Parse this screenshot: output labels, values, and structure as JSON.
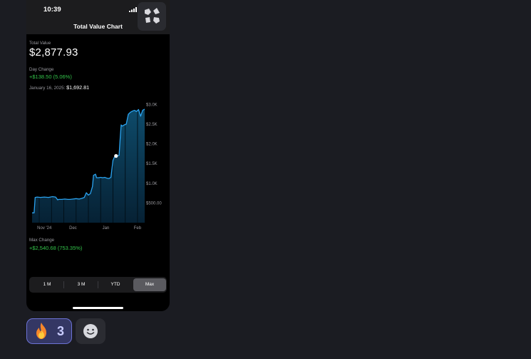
{
  "status_bar": {
    "time": "10:39"
  },
  "nav": {
    "title": "Total Value Chart"
  },
  "summary": {
    "total_value_label": "Total Value",
    "total_value": "$2,877.93",
    "day_change_label": "Day Change",
    "day_change": "+$138.50 (5.06%)",
    "selected_date": "January 16, 2025:",
    "selected_value": "$1,692.81",
    "max_change_label": "Max Change",
    "max_change": "+$2,540.68 (753.35%)"
  },
  "range_selector": {
    "options": [
      "1 M",
      "3 M",
      "YTD",
      "Max"
    ],
    "selected": "Max"
  },
  "reactions": [
    {
      "emoji": "🔥",
      "count": "3",
      "icon": "fire-icon"
    },
    {
      "icon": "smiley-add-icon"
    }
  ],
  "colors": {
    "line": "#2aa3f0",
    "fill_top": "#0f4f70",
    "positive": "#33c44a",
    "reaction_accent": "#6c72d4"
  },
  "chart_data": {
    "type": "area",
    "x_tick_labels": [
      "Nov '24",
      "Dec",
      "Jan",
      "Feb"
    ],
    "y_tick_labels": [
      "$500.00",
      "$1.0K",
      "$1.5K",
      "$2.0K",
      "$2.5K",
      "$3.0K"
    ],
    "y_ticks": [
      500,
      1000,
      1500,
      2000,
      2500,
      3000
    ],
    "ylim": [
      0,
      3150
    ],
    "x_range": [
      "2024-10-26",
      "2025-02-13"
    ],
    "series": [
      {
        "x": [
          "2024-10-26",
          "2024-10-28",
          "2024-10-29",
          "2024-10-31",
          "2024-11-03",
          "2024-11-07",
          "2024-11-11",
          "2024-11-15",
          "2024-11-18",
          "2024-11-20",
          "2024-11-21",
          "2024-11-24",
          "2024-11-27",
          "2024-11-30",
          "2024-12-02",
          "2024-12-05",
          "2024-12-08",
          "2024-12-11",
          "2024-12-14",
          "2024-12-16",
          "2024-12-18",
          "2024-12-20",
          "2024-12-22",
          "2024-12-24",
          "2024-12-25",
          "2024-12-27",
          "2024-12-28",
          "2024-12-30",
          "2025-01-01",
          "2025-01-03",
          "2025-01-05",
          "2025-01-07",
          "2025-01-09",
          "2025-01-11",
          "2025-01-13",
          "2025-01-14",
          "2025-01-15",
          "2025-01-16",
          "2025-01-17",
          "2025-01-18",
          "2025-01-19",
          "2025-01-20",
          "2025-01-21",
          "2025-01-22",
          "2025-01-24",
          "2025-01-26",
          "2025-01-28",
          "2025-01-30",
          "2025-02-01",
          "2025-02-03",
          "2025-02-05",
          "2025-02-07",
          "2025-02-09",
          "2025-02-11",
          "2025-02-13"
        ],
        "values": [
          250,
          250,
          640,
          650,
          640,
          650,
          640,
          660,
          650,
          580,
          590,
          590,
          600,
          590,
          590,
          600,
          610,
          600,
          620,
          640,
          760,
          700,
          740,
          920,
          1200,
          1230,
          1140,
          1140,
          1150,
          1140,
          1150,
          1130,
          1120,
          1150,
          1580,
          1640,
          1692.81,
          1680,
          1700,
          1700,
          1710,
          2120,
          2480,
          2450,
          2480,
          2500,
          2750,
          2800,
          2830,
          2850,
          2820,
          2870,
          2700,
          2850,
          2880
        ]
      }
    ],
    "annotations": [
      {
        "x": "2025-01-16",
        "y": 1692.81,
        "label": "$1,692.81"
      }
    ]
  }
}
